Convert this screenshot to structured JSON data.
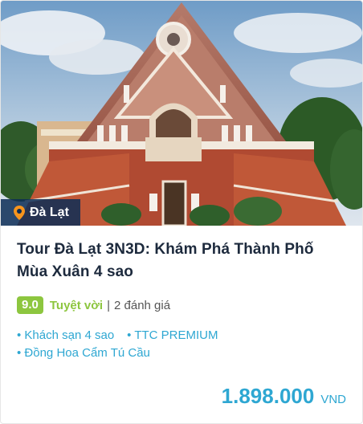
{
  "location": {
    "name": "Đà Lạt",
    "icon": "map-pin-icon"
  },
  "tour": {
    "title": "Tour Đà Lạt 3N3D: Khám Phá Thành Phố Mùa Xuân 4 sao",
    "rating": {
      "score": "9.0",
      "label": "Tuyệt vời",
      "separator": "|",
      "reviews": "2 đánh giá"
    },
    "features": [
      "• Khách sạn 4 sao",
      "• TTC PREMIUM",
      "• Đồng Hoa Cẩm Tú Cầu"
    ],
    "price": "1.898.000",
    "currency": "VND"
  },
  "colors": {
    "accent": "#2ea7d2",
    "rating_green": "#8dc63f",
    "badge_bg": "#0c2d56",
    "title": "#1d2a3d"
  }
}
